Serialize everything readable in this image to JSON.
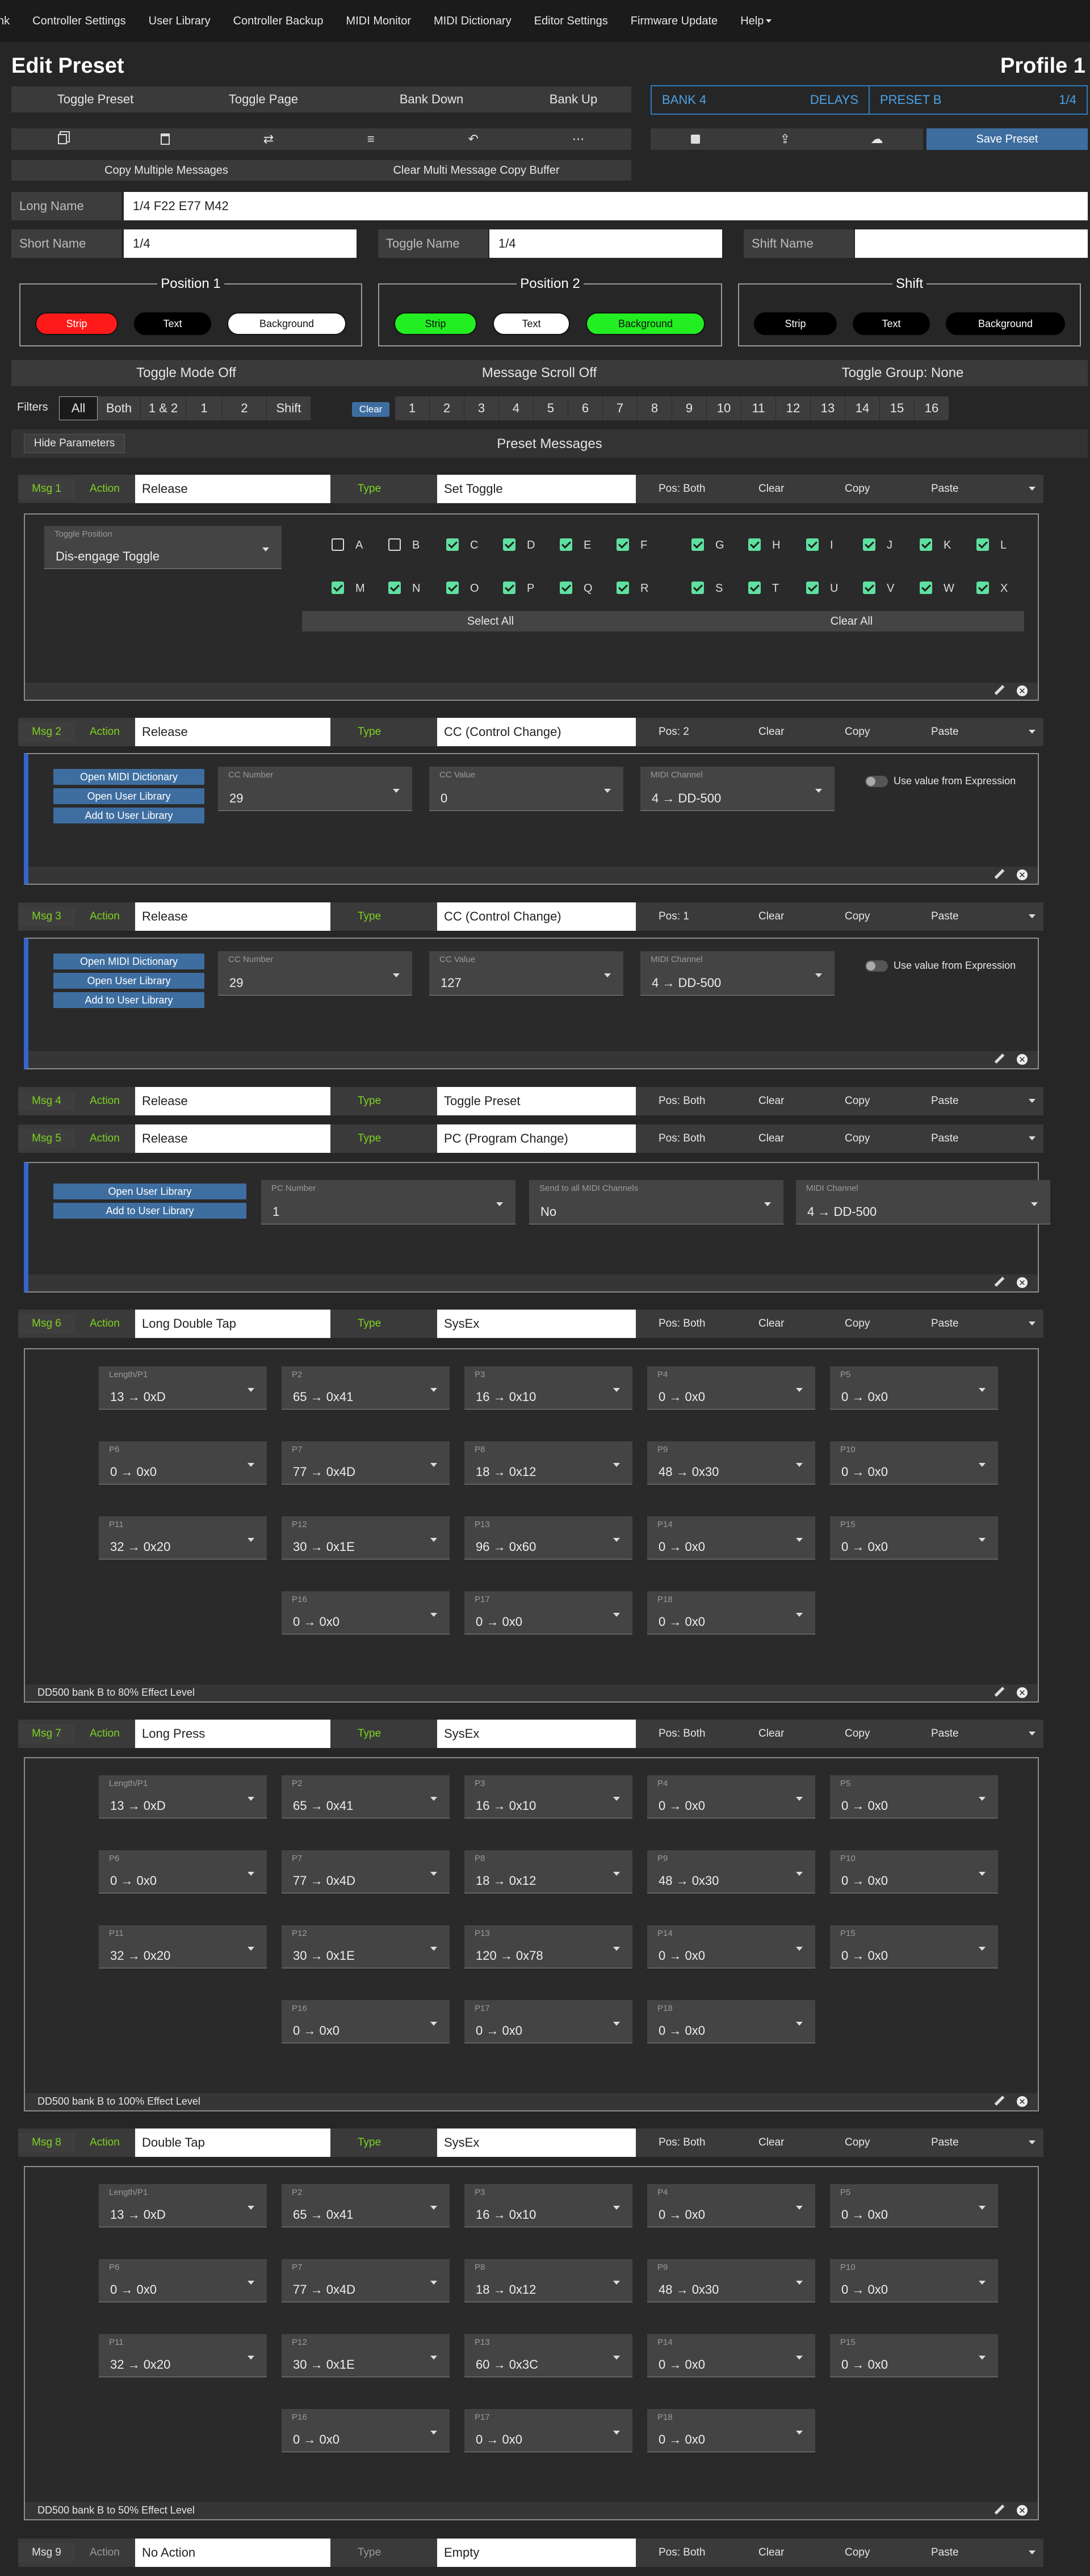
{
  "nav": {
    "items": [
      {
        "label": "nk"
      },
      {
        "label": "Controller Settings"
      },
      {
        "label": "User Library"
      },
      {
        "label": "Controller Backup"
      },
      {
        "label": "MIDI Monitor"
      },
      {
        "label": "MIDI Dictionary"
      },
      {
        "label": "Editor Settings"
      },
      {
        "label": "Firmware Update"
      },
      {
        "label": "Help"
      }
    ]
  },
  "header": {
    "title": "Edit Preset",
    "profile": "Profile 1"
  },
  "toolbar": {
    "toggle_preset": "Toggle Preset",
    "toggle_page": "Toggle Page",
    "bank_down": "Bank Down",
    "bank_up": "Bank Up",
    "copy_multiple": "Copy Multiple Messages",
    "clear_multi": "Clear Multi Message Copy Buffer",
    "save_preset": "Save Preset"
  },
  "bank": {
    "bank": "BANK 4",
    "bank_name": "DELAYS",
    "preset": "PRESET B",
    "preset_name": "1/4"
  },
  "names": {
    "long_label": "Long Name",
    "long_value": "1/4 F22 E77 M42",
    "short_label": "Short Name",
    "short_value": "1/4",
    "toggle_label": "Toggle Name",
    "toggle_value": "1/4",
    "shift_label": "Shift Name",
    "shift_value": ""
  },
  "positions": [
    {
      "title": "Position 1",
      "strip": "Strip",
      "text": "Text",
      "background": "Background"
    },
    {
      "title": "Position 2",
      "strip": "Strip",
      "text": "Text",
      "background": "Background"
    },
    {
      "title": "Shift",
      "strip": "Strip",
      "text": "Text",
      "background": "Background"
    }
  ],
  "modes": {
    "toggle_mode": "Toggle Mode Off",
    "scroll": "Message Scroll Off",
    "group": "Toggle Group: None"
  },
  "filters": {
    "label": "Filters",
    "pos": [
      "All",
      "Both",
      "1 & 2",
      "1",
      "2",
      "Shift"
    ],
    "clear": "Clear",
    "nums": [
      "1",
      "2",
      "3",
      "4",
      "5",
      "6",
      "7",
      "8",
      "9",
      "10",
      "11",
      "12",
      "13",
      "14",
      "15",
      "16"
    ]
  },
  "section": {
    "hide_params": "Hide Parameters",
    "title": "Preset Messages"
  },
  "common": {
    "action": "Action",
    "type": "Type",
    "clear": "Clear",
    "copy": "Copy",
    "paste": "Paste"
  },
  "messages": [
    {
      "badge": "Msg 1",
      "action": "Release",
      "type": "Set Toggle",
      "pos": "Pos: Both"
    },
    {
      "badge": "Msg 2",
      "action": "Release",
      "type": "CC (Control Change)",
      "pos": "Pos: 2"
    },
    {
      "badge": "Msg 3",
      "action": "Release",
      "type": "CC (Control Change)",
      "pos": "Pos: 1"
    },
    {
      "badge": "Msg 4",
      "action": "Release",
      "type": "Toggle Preset",
      "pos": "Pos: Both"
    },
    {
      "badge": "Msg 5",
      "action": "Release",
      "type": "PC (Program Change)",
      "pos": "Pos: Both"
    },
    {
      "badge": "Msg 6",
      "action": "Long Double Tap",
      "type": "SysEx",
      "pos": "Pos: Both"
    },
    {
      "badge": "Msg 7",
      "action": "Long Press",
      "type": "SysEx",
      "pos": "Pos: Both"
    },
    {
      "badge": "Msg 8",
      "action": "Double Tap",
      "type": "SysEx",
      "pos": "Pos: Both"
    },
    {
      "badge": "Msg 9",
      "action": "No Action",
      "type": "Empty",
      "pos": "Pos: Both"
    }
  ],
  "msg1": {
    "toggle_pos_label": "Toggle Position",
    "toggle_pos_value": "Dis-engage Toggle",
    "letters_row1": [
      {
        "l": "A",
        "on": false
      },
      {
        "l": "B",
        "on": false
      },
      {
        "l": "C",
        "on": true
      },
      {
        "l": "D",
        "on": true
      },
      {
        "l": "E",
        "on": true
      },
      {
        "l": "F",
        "on": true
      },
      {
        "l": "G",
        "on": true
      },
      {
        "l": "H",
        "on": true
      },
      {
        "l": "I",
        "on": true
      },
      {
        "l": "J",
        "on": true
      },
      {
        "l": "K",
        "on": true
      },
      {
        "l": "L",
        "on": true
      }
    ],
    "letters_row2": [
      {
        "l": "M",
        "on": true
      },
      {
        "l": "N",
        "on": true
      },
      {
        "l": "O",
        "on": true
      },
      {
        "l": "P",
        "on": true
      },
      {
        "l": "Q",
        "on": true
      },
      {
        "l": "R",
        "on": true
      },
      {
        "l": "S",
        "on": true
      },
      {
        "l": "T",
        "on": true
      },
      {
        "l": "U",
        "on": true
      },
      {
        "l": "V",
        "on": true
      },
      {
        "l": "W",
        "on": true
      },
      {
        "l": "X",
        "on": true
      }
    ],
    "select_all": "Select All",
    "clear_all": "Clear All"
  },
  "cc_buttons": {
    "open_dict": "Open MIDI Dictionary",
    "open_lib": "Open User Library",
    "add_lib": "Add to User Library"
  },
  "msg2": {
    "cc_num_label": "CC Number",
    "cc_num": "29",
    "cc_val_label": "CC Value",
    "cc_val": "0",
    "ch_label": "MIDI Channel",
    "ch": "4 → DD-500",
    "expr": "Use value from Expression"
  },
  "msg3": {
    "cc_num_label": "CC Number",
    "cc_num": "29",
    "cc_val_label": "CC Value",
    "cc_val": "127",
    "ch_label": "MIDI Channel",
    "ch": "4 → DD-500",
    "expr": "Use value from Expression"
  },
  "msg5": {
    "pc_label": "PC Number",
    "pc": "1",
    "send_label": "Send to all MIDI Channels",
    "send": "No",
    "ch_label": "MIDI Channel",
    "ch": "4 → DD-500"
  },
  "sysex": [
    {
      "params": [
        {
          "l": "Length/P1",
          "v": "13 → 0xD"
        },
        {
          "l": "P2",
          "v": "65 → 0x41"
        },
        {
          "l": "P3",
          "v": "16 → 0x10"
        },
        {
          "l": "P4",
          "v": "0 → 0x0"
        },
        {
          "l": "P5",
          "v": "0 → 0x0"
        },
        {
          "l": "P6",
          "v": "0 → 0x0"
        },
        {
          "l": "P7",
          "v": "77 → 0x4D"
        },
        {
          "l": "P8",
          "v": "18 → 0x12"
        },
        {
          "l": "P9",
          "v": "48 → 0x30"
        },
        {
          "l": "P10",
          "v": "0 → 0x0"
        },
        {
          "l": "P11",
          "v": "32 → 0x20"
        },
        {
          "l": "P12",
          "v": "30 → 0x1E"
        },
        {
          "l": "P13",
          "v": "96 → 0x60"
        },
        {
          "l": "P14",
          "v": "0 → 0x0"
        },
        {
          "l": "P15",
          "v": "0 → 0x0"
        },
        {
          "l": "P16",
          "v": "0 → 0x0"
        },
        {
          "l": "P17",
          "v": "0 → 0x0"
        },
        {
          "l": "P18",
          "v": "0 → 0x0"
        }
      ],
      "foot": "DD500 bank B to 80% Effect Level"
    },
    {
      "params": [
        {
          "l": "Length/P1",
          "v": "13 → 0xD"
        },
        {
          "l": "P2",
          "v": "65 → 0x41"
        },
        {
          "l": "P3",
          "v": "16 → 0x10"
        },
        {
          "l": "P4",
          "v": "0 → 0x0"
        },
        {
          "l": "P5",
          "v": "0 → 0x0"
        },
        {
          "l": "P6",
          "v": "0 → 0x0"
        },
        {
          "l": "P7",
          "v": "77 → 0x4D"
        },
        {
          "l": "P8",
          "v": "18 → 0x12"
        },
        {
          "l": "P9",
          "v": "48 → 0x30"
        },
        {
          "l": "P10",
          "v": "0 → 0x0"
        },
        {
          "l": "P11",
          "v": "32 → 0x20"
        },
        {
          "l": "P12",
          "v": "30 → 0x1E"
        },
        {
          "l": "P13",
          "v": "120 → 0x78"
        },
        {
          "l": "P14",
          "v": "0 → 0x0"
        },
        {
          "l": "P15",
          "v": "0 → 0x0"
        },
        {
          "l": "P16",
          "v": "0 → 0x0"
        },
        {
          "l": "P17",
          "v": "0 → 0x0"
        },
        {
          "l": "P18",
          "v": "0 → 0x0"
        }
      ],
      "foot": "DD500 bank B to 100% Effect Level"
    },
    {
      "params": [
        {
          "l": "Length/P1",
          "v": "13 → 0xD"
        },
        {
          "l": "P2",
          "v": "65 → 0x41"
        },
        {
          "l": "P3",
          "v": "16 → 0x10"
        },
        {
          "l": "P4",
          "v": "0 → 0x0"
        },
        {
          "l": "P5",
          "v": "0 → 0x0"
        },
        {
          "l": "P6",
          "v": "0 → 0x0"
        },
        {
          "l": "P7",
          "v": "77 → 0x4D"
        },
        {
          "l": "P8",
          "v": "18 → 0x12"
        },
        {
          "l": "P9",
          "v": "48 → 0x30"
        },
        {
          "l": "P10",
          "v": "0 → 0x0"
        },
        {
          "l": "P11",
          "v": "32 → 0x20"
        },
        {
          "l": "P12",
          "v": "30 → 0x1E"
        },
        {
          "l": "P13",
          "v": "60 → 0x3C"
        },
        {
          "l": "P14",
          "v": "0 → 0x0"
        },
        {
          "l": "P15",
          "v": "0 → 0x0"
        },
        {
          "l": "P16",
          "v": "0 → 0x0"
        },
        {
          "l": "P17",
          "v": "0 → 0x0"
        },
        {
          "l": "P18",
          "v": "0 → 0x0"
        }
      ],
      "foot": "DD500 bank B to 50% Effect Level"
    }
  ],
  "colors": {
    "accent": "#3e6ea0",
    "green": "#7ed321",
    "check": "#5fe0a0",
    "strip_red": "#ff1a1a",
    "strip_green": "#22ee22"
  }
}
